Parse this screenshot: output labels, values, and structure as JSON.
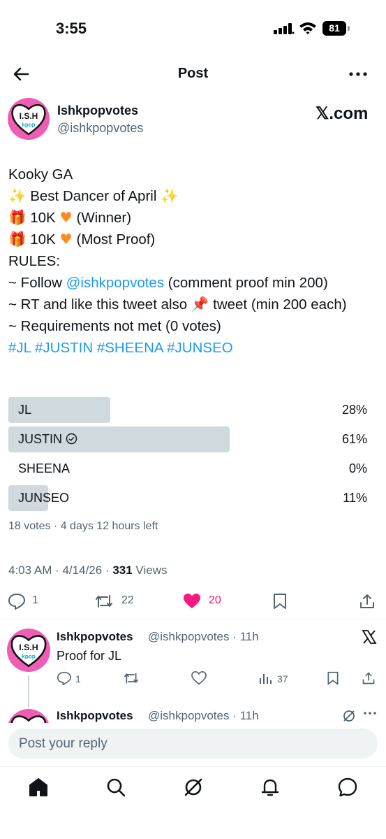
{
  "status_bar": {
    "time": "3:55",
    "battery": "81"
  },
  "header": {
    "title": "Post"
  },
  "author": {
    "name": "Ishkpopvotes",
    "handle": "@ishkpopvotes",
    "avatar_text": "I.S.H",
    "avatar_subtext": "kpop",
    "source": "𝕏.com"
  },
  "tweet": {
    "line1": "Kooky GA",
    "line2_text": " Best Dancer of April ",
    "line3_amount": " 10K ",
    "line3_tail": " (Winner)",
    "line4_amount": " 10K ",
    "line4_tail": " (Most Proof)",
    "rules": "RULES:",
    "rule1_prefix": "~ Follow ",
    "rule1_mention": "@ishkpopvotes",
    "rule1_suffix": " (comment proof min 200)",
    "rule2_prefix": "~ RT and like this tweet also ",
    "rule2_suffix": " tweet (min 200 each)",
    "rule3": "~ Requirements not met (0 votes)",
    "hashtags": [
      "#JL",
      "#JUSTIN",
      "#SHEENA",
      "#JUNSEO"
    ]
  },
  "poll": {
    "options": [
      {
        "label": "JL",
        "percent_label": "28%",
        "fraction": 0.28
      },
      {
        "label": "JUSTIN",
        "percent_label": "61%",
        "fraction": 0.61,
        "winner": true
      },
      {
        "label": "SHEENA",
        "percent_label": "0%",
        "fraction": 0.0
      },
      {
        "label": "JUNSEO",
        "percent_label": "11%",
        "fraction": 0.11
      }
    ],
    "meta": "18 votes · 4 days 12 hours left"
  },
  "timestamp": {
    "time": "4:03 AM · 4/14/26 · ",
    "views_count": "331",
    "views_label": " Views"
  },
  "actions": {
    "replies": "1",
    "reposts": "22",
    "likes": "20",
    "like_color": "#f91880"
  },
  "reply": {
    "name": "Ishkpopvotes",
    "handle": "@ishkpopvotes",
    "time": "· 11h",
    "text": "Proof for JL",
    "replies": "1",
    "views": "37"
  },
  "next_reply": {
    "name": "Ishkpopvotes",
    "handle": "@ishkpopvotes",
    "time": "· 11h"
  },
  "reply_box": {
    "placeholder": "Post your reply"
  },
  "colors": {
    "accent": "#1d9bf0",
    "avatar_bg": "#ee5fb4",
    "poll_bar": "#cfd9de"
  }
}
